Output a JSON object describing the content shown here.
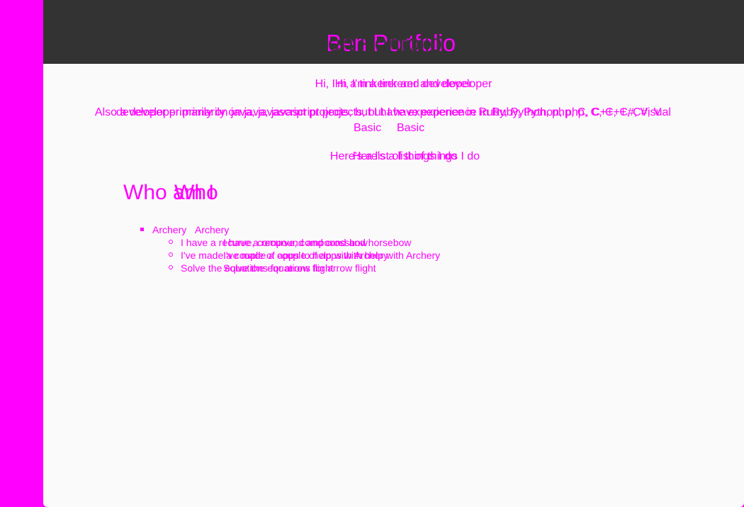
{
  "header": {
    "title": "Ben Portfolio",
    "title_ghost": "Ben Portfolio"
  },
  "intro": {
    "line": "Hi, I'm a tinkerer and developer",
    "line_ghost": "Hi, I'm a tinkerer and developer"
  },
  "languages": {
    "line": "developer primarily on java, javascript projects, but I have experience in Ruby, Python, php, C, C++, C#, Visual",
    "line_ghost": "Also a developer primarily on java, javascript projects, but I have experience in Ruby, Python, php, C, C++, C#, V",
    "basic": "Basic",
    "basic_ghost": "Basic"
  },
  "things": {
    "line": "Here's a list of things I do",
    "line_ghost": "Here's a list of things I do"
  },
  "who": {
    "heading": "Who am I",
    "heading_ghost": "Who"
  },
  "list": {
    "item": "Archery",
    "item_ghost": "Archery",
    "subitems": [
      "I have a recurve, compound and crossbow",
      "I've made a couple of apps to help with Archery",
      "Solve the equations for arrow flight"
    ],
    "subitems_ghost": [
      "I have a recurve, compound and horsebow",
      "I've made a couple of apps with help with Archery",
      "Solve the equations for arrow flight"
    ]
  },
  "colors": {
    "background": "#ff00ff",
    "page": "#fafafa",
    "topbar": "#333333",
    "text": "#ff00ff"
  }
}
